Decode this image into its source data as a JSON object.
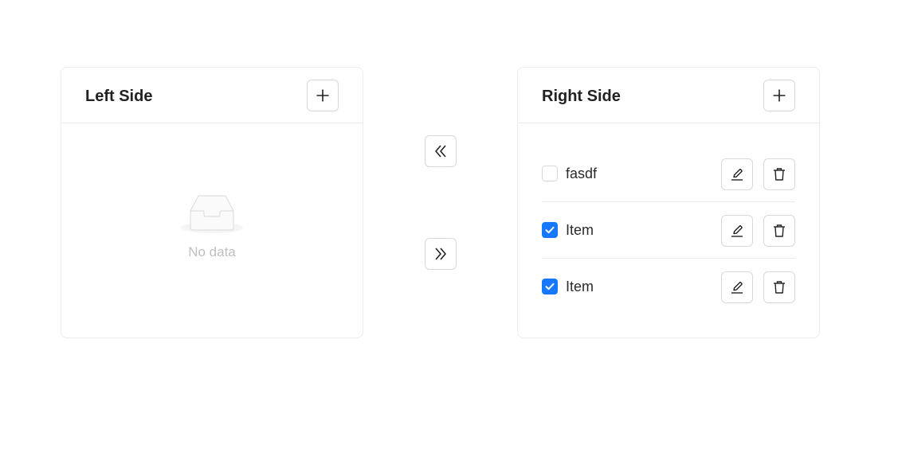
{
  "left_panel": {
    "title": "Left Side",
    "add_icon": "plus-icon",
    "empty_icon": "empty-inbox-icon",
    "empty_text": "No data"
  },
  "transfer": {
    "to_left_icon": "double-chevron-left-icon",
    "to_right_icon": "double-chevron-right-icon"
  },
  "right_panel": {
    "title": "Right Side",
    "add_icon": "plus-icon",
    "items": [
      {
        "label": "fasdf",
        "checked": false
      },
      {
        "label": "Item",
        "checked": true
      },
      {
        "label": "Item",
        "checked": true
      }
    ],
    "edit_icon": "edit-pen-icon",
    "delete_icon": "trash-icon"
  },
  "colors": {
    "accent": "#1677ff",
    "border": "#d9d9d9",
    "divider": "#ececec",
    "muted_text": "#bfbfbf"
  }
}
